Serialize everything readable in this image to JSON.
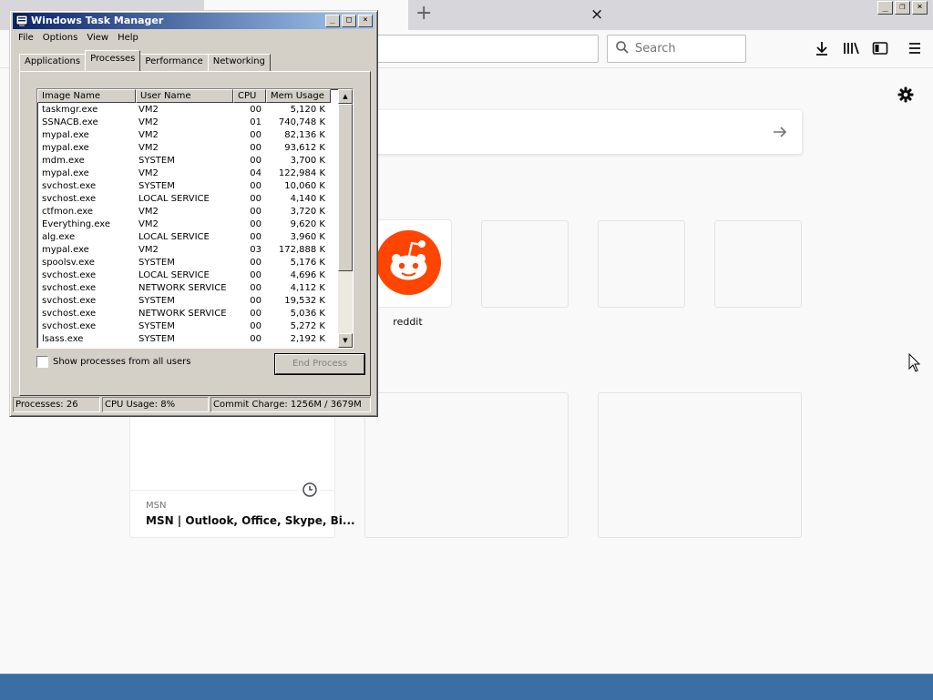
{
  "browser": {
    "tab_close_glyph": "×",
    "new_tab_glyph": "+",
    "window_controls": [
      "_",
      "❐",
      "×"
    ],
    "search_placeholder": "Search"
  },
  "newtab": {
    "top_sites": [
      {
        "label": "reddit"
      }
    ],
    "highlight": {
      "source": "MSN",
      "title": "MSN | Outlook, Office, Skype, Bi..."
    }
  },
  "task_manager": {
    "title": "Windows Task Manager",
    "title_buttons": [
      "_",
      "□",
      "×"
    ],
    "menu": [
      "File",
      "Options",
      "View",
      "Help"
    ],
    "tabs": [
      "Applications",
      "Processes",
      "Performance",
      "Networking"
    ],
    "active_tab": "Processes",
    "columns": [
      "Image Name",
      "User Name",
      "CPU",
      "Mem Usage"
    ],
    "rows": [
      [
        "taskmgr.exe",
        "VM2",
        "00",
        "5,120 K"
      ],
      [
        "SSNACB.exe",
        "VM2",
        "01",
        "740,748 K"
      ],
      [
        "mypal.exe",
        "VM2",
        "00",
        "82,136 K"
      ],
      [
        "mypal.exe",
        "VM2",
        "00",
        "93,612 K"
      ],
      [
        "mdm.exe",
        "SYSTEM",
        "00",
        "3,700 K"
      ],
      [
        "mypal.exe",
        "VM2",
        "04",
        "122,984 K"
      ],
      [
        "svchost.exe",
        "SYSTEM",
        "00",
        "10,060 K"
      ],
      [
        "svchost.exe",
        "LOCAL SERVICE",
        "00",
        "4,140 K"
      ],
      [
        "ctfmon.exe",
        "VM2",
        "00",
        "3,720 K"
      ],
      [
        "Everything.exe",
        "VM2",
        "00",
        "9,620 K"
      ],
      [
        "alg.exe",
        "LOCAL SERVICE",
        "00",
        "3,960 K"
      ],
      [
        "mypal.exe",
        "VM2",
        "03",
        "172,888 K"
      ],
      [
        "spoolsv.exe",
        "SYSTEM",
        "00",
        "5,176 K"
      ],
      [
        "svchost.exe",
        "LOCAL SERVICE",
        "00",
        "4,696 K"
      ],
      [
        "svchost.exe",
        "NETWORK SERVICE",
        "00",
        "4,112 K"
      ],
      [
        "svchost.exe",
        "SYSTEM",
        "00",
        "19,532 K"
      ],
      [
        "svchost.exe",
        "NETWORK SERVICE",
        "00",
        "5,036 K"
      ],
      [
        "svchost.exe",
        "SYSTEM",
        "00",
        "5,272 K"
      ],
      [
        "lsass.exe",
        "SYSTEM",
        "00",
        "2,192 K"
      ]
    ],
    "show_all_label": "Show processes from all users",
    "end_process_label": "End Process",
    "status": {
      "processes": "Processes: 26",
      "cpu": "CPU Usage: 8%",
      "commit": "Commit Charge: 1256M / 3679M"
    }
  },
  "colors": {
    "reddit": "#ff4500",
    "titlebar_start": "#0a246a",
    "titlebar_end": "#a6caf0",
    "taskbar": "#3a6ea5"
  },
  "icons": [
    "download-icon",
    "library-icon",
    "sidebar-icon",
    "menu-icon",
    "search-icon",
    "gear-icon",
    "arrow-right-icon",
    "clock-icon",
    "reddit-alien-icon",
    "task-manager-icon",
    "mouse-pointer-icon"
  ]
}
